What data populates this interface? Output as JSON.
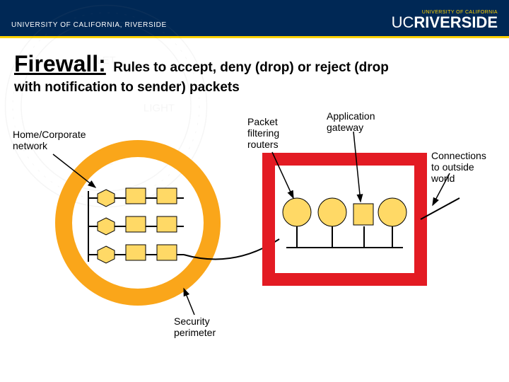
{
  "header": {
    "left_text": "UNIVERSITY OF CALIFORNIA, RIVERSIDE",
    "right_super": "UNIVERSITY OF CALIFORNIA",
    "right_prefix": "UC",
    "right_main": "RIVERSIDE"
  },
  "title": {
    "main": "Firewall:",
    "sub": "Rules to accept, deny (drop) or reject (drop",
    "sub2": "with notification to sender) packets"
  },
  "labels": {
    "home_network": "Home/Corporate\nnetwork",
    "packet_filtering": "Packet\nfiltering\nrouters",
    "app_gateway": "Application\ngateway",
    "connections": "Connections\nto outside\nworld",
    "sec_perimeter": "Security\nperimeter"
  },
  "colors": {
    "perimeter_ring": "#faa61a",
    "firewall_box": "#e31b23",
    "shape_fill": "#ffd966",
    "header_bg": "#002855"
  }
}
